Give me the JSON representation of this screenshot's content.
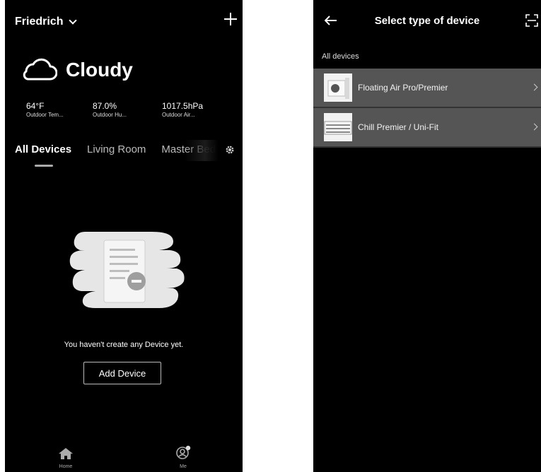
{
  "left": {
    "home_name": "Friedrich",
    "weather": {
      "condition": "Cloudy",
      "icon": "cloud-icon"
    },
    "stats": [
      {
        "value": "64°F",
        "label": "Outdoor Tem..."
      },
      {
        "value": "87.0%",
        "label": "Outdoor Hu..."
      },
      {
        "value": "1017.5hPa",
        "label": "Outdoor Air..."
      }
    ],
    "tabs": [
      "All Devices",
      "Living Room",
      "Master Bed"
    ],
    "empty_message": "You haven't create any Device yet.",
    "add_button": "Add Device",
    "nav": {
      "home": "Home",
      "me": "Me"
    }
  },
  "right": {
    "title": "Select type of device",
    "section": "All devices",
    "items": [
      {
        "label": "Floating Air Pro/Premier",
        "icon": "mini-split-icon"
      },
      {
        "label": "Chill Premier / Uni-Fit",
        "icon": "window-ac-icon"
      }
    ]
  }
}
